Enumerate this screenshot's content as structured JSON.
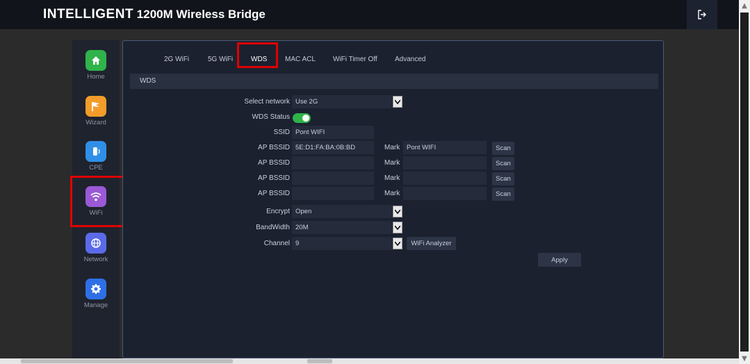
{
  "header": {
    "brand_bold": "INTELLIGENT",
    "brand_rest": "1200M Wireless Bridge"
  },
  "sidebar": {
    "items": [
      {
        "label": "Home",
        "icon": "home-icon",
        "color": "#2fb34a"
      },
      {
        "label": "Wizard",
        "icon": "flag-icon",
        "color": "#f39c2a"
      },
      {
        "label": "CPE",
        "icon": "cpe-icon",
        "color": "#2f8fe6"
      },
      {
        "label": "WiFi",
        "icon": "wifi-icon",
        "color": "#9b59d6"
      },
      {
        "label": "Network",
        "icon": "globe-icon",
        "color": "#5b6ae8"
      },
      {
        "label": "Manage",
        "icon": "gear-icon",
        "color": "#2f6fe6"
      }
    ],
    "active": "WiFi"
  },
  "tabs": [
    "2G WiFi",
    "5G WiFi",
    "WDS",
    "MAC ACL",
    "WiFi Timer Off",
    "Advanced"
  ],
  "active_tab": "WDS",
  "section_title": "WDS",
  "form": {
    "select_network": {
      "label": "Select network",
      "value": "Use 2G"
    },
    "wds_status": {
      "label": "WDS Status",
      "on": true
    },
    "ssid": {
      "label": "SSID",
      "value": "Pont WIFI"
    },
    "ap_rows": [
      {
        "label": "AP BSSID",
        "value": "5E:D1:FA:BA:0B:BD",
        "mark_label": "Mark",
        "mark_value": "Pont WIFI",
        "scan": "Scan"
      },
      {
        "label": "AP BSSID",
        "value": "",
        "mark_label": "Mark",
        "mark_value": "",
        "scan": "Scan"
      },
      {
        "label": "AP BSSID",
        "value": "",
        "mark_label": "Mark",
        "mark_value": "",
        "scan": "Scan"
      },
      {
        "label": "AP BSSID",
        "value": "",
        "mark_label": "Mark",
        "mark_value": "",
        "scan": "Scan"
      }
    ],
    "encrypt": {
      "label": "Encrypt",
      "value": "Open"
    },
    "bandwidth": {
      "label": "BandWidth",
      "value": "20M"
    },
    "channel": {
      "label": "Channel",
      "value": "9"
    },
    "analyzer_button": "WiFi Analyzer",
    "apply_button": "Apply"
  },
  "colors": {
    "accent_red": "#e00000",
    "toggle_on": "#2fb34a",
    "panel_bg": "#1c2130"
  }
}
